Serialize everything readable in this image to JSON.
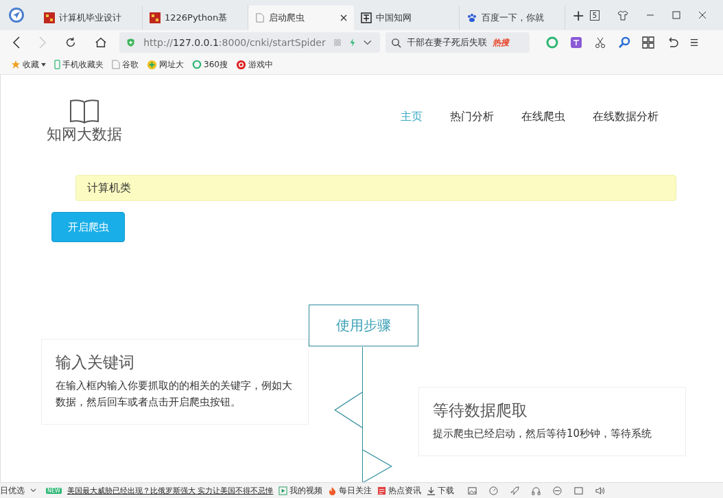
{
  "browser": {
    "tabs": [
      {
        "title": "计算机毕业设计",
        "kind": "flag",
        "selected": false
      },
      {
        "title": "1226Python基",
        "kind": "flag",
        "selected": false
      },
      {
        "title": "启动爬虫",
        "kind": "page",
        "selected": true
      },
      {
        "title": "中国知网",
        "kind": "logo",
        "selected": false
      },
      {
        "title": "百度一下，你就",
        "kind": "paw",
        "selected": false
      }
    ],
    "new_tab": "+",
    "tab_count": "5",
    "address": {
      "prefix": "http://",
      "host": "127.0.0.1",
      "rest": ":8000/cnki/startSpider"
    },
    "search": {
      "query": "干部在妻子死后失联",
      "badge": "热搜"
    },
    "bookmarks": [
      {
        "label": "收藏",
        "kind": "star"
      },
      {
        "label": "手机收藏夹",
        "kind": "phone"
      },
      {
        "label": "谷歌",
        "kind": "page"
      },
      {
        "label": "网址大",
        "kind": "globe"
      },
      {
        "label": "360搜",
        "kind": "ring"
      },
      {
        "label": "游戏中",
        "kind": "game"
      }
    ]
  },
  "page": {
    "logo": "知网大数据",
    "nav": [
      {
        "label": "主页",
        "selected": true
      },
      {
        "label": "热门分析",
        "selected": false
      },
      {
        "label": "在线爬虫",
        "selected": false
      },
      {
        "label": "在线数据分析",
        "selected": false
      }
    ],
    "keyword_field": {
      "value": "计算机类"
    },
    "start_button": "开启爬虫",
    "timeline": {
      "title": "使用步骤",
      "steps": [
        {
          "title": "输入关键词",
          "text": "在输入框内输入你要抓取的的相关的关键字，例如大数据，然后回车或者点击开启爬虫按钮。"
        },
        {
          "title": "等待数据爬取",
          "text": "提示爬虫已经启动，然后等待10秒钟，等待系统"
        }
      ]
    }
  },
  "status_bar": {
    "left": "日优选",
    "news_badge": "NEW",
    "headline": "美国最大威胁已经出现？比俄罗斯强大 实力让美国不得不忌惮",
    "items": [
      {
        "label": "我的视频",
        "kind": "play"
      },
      {
        "label": "每日关注",
        "kind": "flame"
      },
      {
        "label": "热点资讯",
        "kind": "news"
      },
      {
        "label": "下载",
        "kind": "download"
      }
    ]
  }
}
